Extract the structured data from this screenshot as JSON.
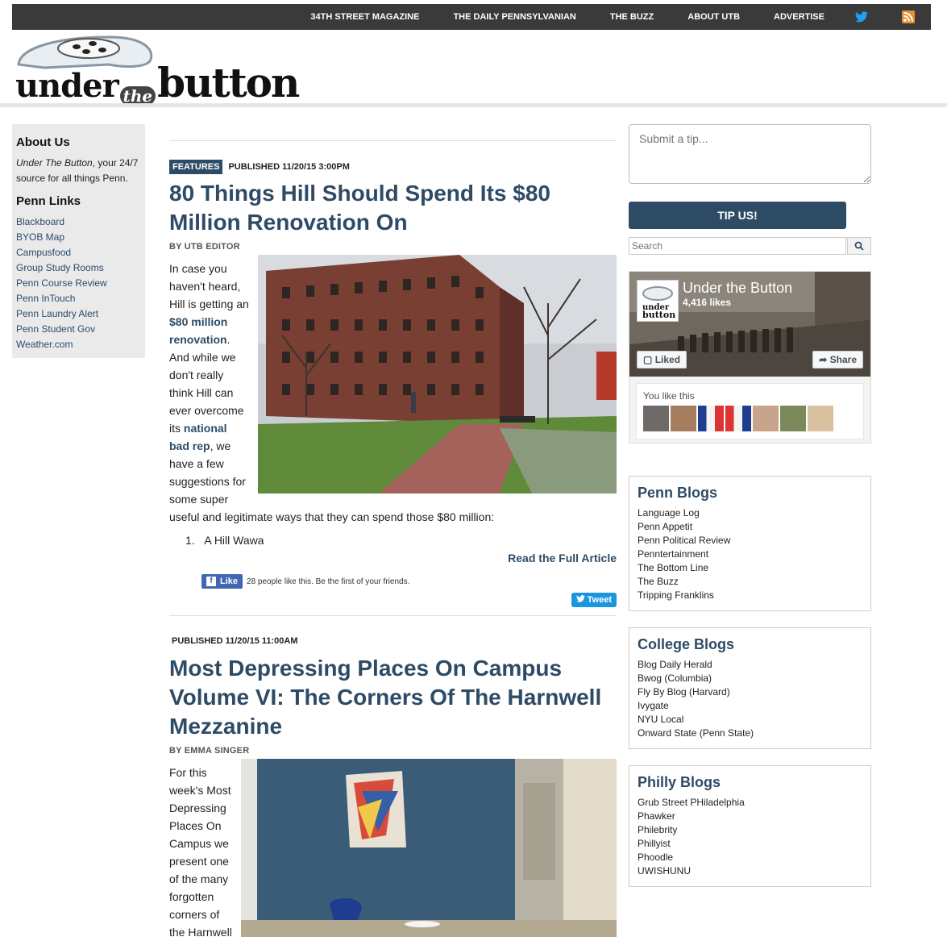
{
  "topnav": {
    "items": [
      "34TH STREET MAGAZINE",
      "THE DAILY PENNSYLVANIAN",
      "THE BUZZ",
      "ABOUT UTB",
      "ADVERTISE"
    ],
    "icons": [
      "twitter-icon",
      "rss-icon"
    ]
  },
  "logo": {
    "under": "under",
    "the": "the",
    "button": "button"
  },
  "left": {
    "about_title": "About Us",
    "about_italic": "Under The Button",
    "about_text": ", your 24/7 source for all things Penn.",
    "links_title": "Penn Links",
    "links": [
      "Blackboard",
      "BYOB Map",
      "Campusfood",
      "Group Study Rooms",
      "Penn Course Review",
      "Penn InTouch",
      "Penn Laundry Alert",
      "Penn Student Gov",
      "Weather.com"
    ]
  },
  "post1": {
    "tag": "FEATURES",
    "published": "PUBLISHED 11/20/15 3:00PM",
    "title": "80 Things Hill Should Spend Its $80 Million Renovation On",
    "byline": "BY UTB EDITOR",
    "text_a": "In case you haven't heard, Hill is getting an ",
    "link_a": "$80 million renovation",
    "text_b": ". And while we don't really think Hill can ever overcome its ",
    "link_b": "national bad rep",
    "text_c": ", we have a few suggestions for some super useful and legitimate ways that they can spend those $80 million:",
    "list_num": "1.",
    "list_item": "A Hill Wawa",
    "readmore": "Read the Full Article",
    "fb_like": "Like",
    "fb_count": "28 people like this. Be the first of your friends.",
    "tweet": "Tweet"
  },
  "post2": {
    "published": "PUBLISHED 11/20/15 11:00AM",
    "title": "Most Depressing Places On Campus Volume VI: The Corners Of The Harnwell Mezzanine",
    "byline": "BY EMMA SINGER",
    "text": "For this week's Most Depressing Places On Campus we present one of the many forgotten corners of the Harnwell"
  },
  "right": {
    "tip_placeholder": "Submit a tip...",
    "tip_button": "TIP US!",
    "search_placeholder": "Search",
    "fb": {
      "name": "Under the Button",
      "likes": "4,416 likes",
      "liked": "Liked",
      "share": "Share",
      "you_like": "You like this"
    },
    "penn_blogs": {
      "title": "Penn Blogs",
      "items": [
        "Language Log",
        "Penn Appetit",
        "Penn Political Review",
        "Penntertainment",
        "The Bottom Line",
        "The Buzz",
        "Tripping Franklins"
      ]
    },
    "college_blogs": {
      "title": "College Blogs",
      "items": [
        "Blog Daily Herald",
        "Bwog (Columbia)",
        "Fly By Blog (Harvard)",
        "Ivygate",
        "NYU Local",
        "Onward State (Penn State)"
      ]
    },
    "philly_blogs": {
      "title": "Philly Blogs",
      "items": [
        "Grub Street PHiladelphia",
        "Phawker",
        "Philebrity",
        "Phillyist",
        "Phoodle",
        "UWISHUNU"
      ]
    }
  }
}
